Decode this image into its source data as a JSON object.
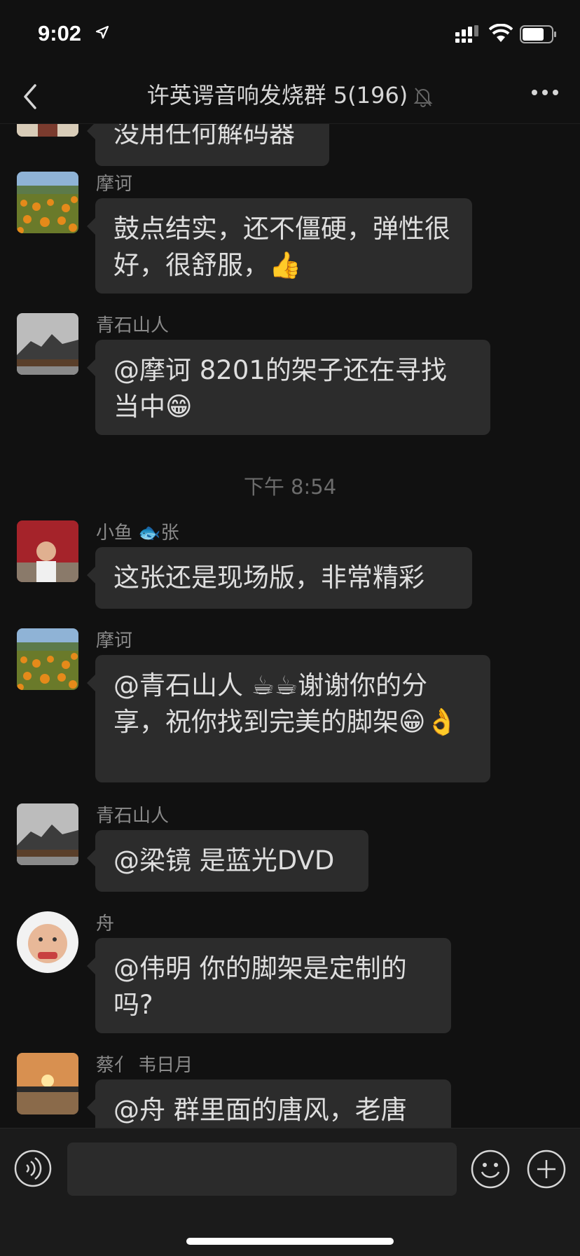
{
  "status_bar": {
    "time": "9:02"
  },
  "nav": {
    "title": "许英谔音响发烧群 5(196)"
  },
  "messages": [
    {
      "text": "没用任何解码器"
    },
    {
      "sender": "摩诃",
      "text": "鼓点结实，还不僵硬，弹性很好，很舒服，👍"
    },
    {
      "sender": "青石山人",
      "text": "@摩诃 8201的架子还在寻找当中😁"
    },
    {
      "timestamp": "下午 8:54"
    },
    {
      "sender": "小鱼 🐟张",
      "text": "这张还是现场版，非常精彩"
    },
    {
      "sender": "摩诃",
      "text": "@青石山人 ☕☕谢谢你的分享，祝你找到完美的脚架😁👌"
    },
    {
      "sender": "青石山人",
      "text": "@梁镜 是蓝光DVD"
    },
    {
      "sender": "舟",
      "text": "@伟明 你的脚架是定制的吗?"
    },
    {
      "sender": "蔡亻 韦日月",
      "text": "@舟 群里面的唐风，老唐"
    }
  ],
  "input": {
    "placeholder": ""
  },
  "colors": {
    "background": "#111111",
    "bubble": "#2c2c2c",
    "text": "#dedede",
    "sender": "#8a8a8a"
  }
}
